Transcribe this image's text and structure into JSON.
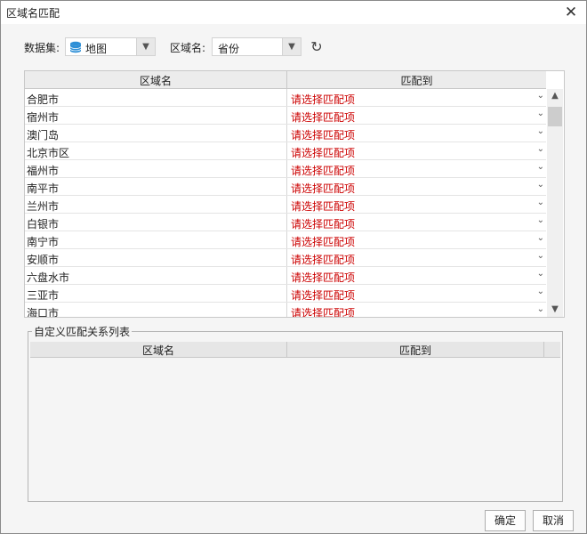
{
  "window": {
    "title": "区域名匹配"
  },
  "toolbar": {
    "dataset_label": "数据集:",
    "dataset_value": "地图",
    "field_label": "区域名:",
    "field_value": "省份"
  },
  "table": {
    "col_name": "区域名",
    "col_match": "匹配到",
    "placeholder": "请选择匹配项",
    "rows": [
      "合肥市",
      "宿州市",
      "澳门岛",
      "北京市区",
      "福州市",
      "南平市",
      "兰州市",
      "白银市",
      "南宁市",
      "安顺市",
      "六盘水市",
      "三亚市",
      "海口市"
    ]
  },
  "custom": {
    "legend": "自定义匹配关系列表",
    "col_name": "区域名",
    "col_match": "匹配到"
  },
  "buttons": {
    "ok": "确定",
    "cancel": "取消"
  },
  "colors": {
    "placeholder": "#cc0000",
    "db_icon": "#2e8fd6"
  }
}
